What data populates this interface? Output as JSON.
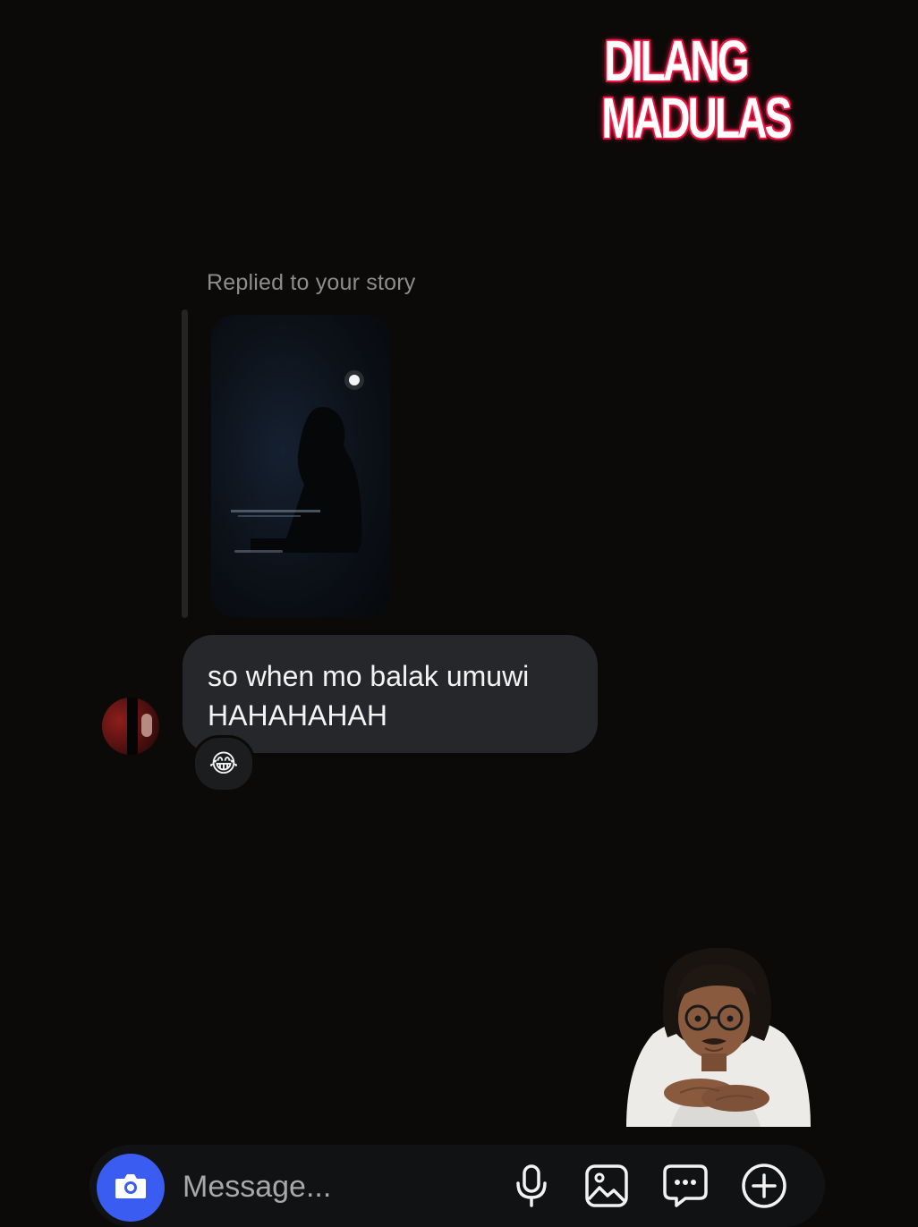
{
  "overlay": {
    "logo_line1": "DILANG",
    "logo_line2": "MADULAS"
  },
  "thread": {
    "reply_label": "Replied to your story",
    "message": {
      "line1": "so when mo balak umuwi",
      "line2": "HAHAHAHAH"
    },
    "reaction_emoji": "😂"
  },
  "composer": {
    "placeholder": "Message...",
    "icons": [
      "camera-icon",
      "microphone-icon",
      "gallery-icon",
      "chat-bubble-icon",
      "add-circle-icon"
    ]
  },
  "colors": {
    "background": "#0b0a08",
    "bubble": "#25272a",
    "accent": "#3a5cf0",
    "logo_glow": "#ff1f4b"
  }
}
